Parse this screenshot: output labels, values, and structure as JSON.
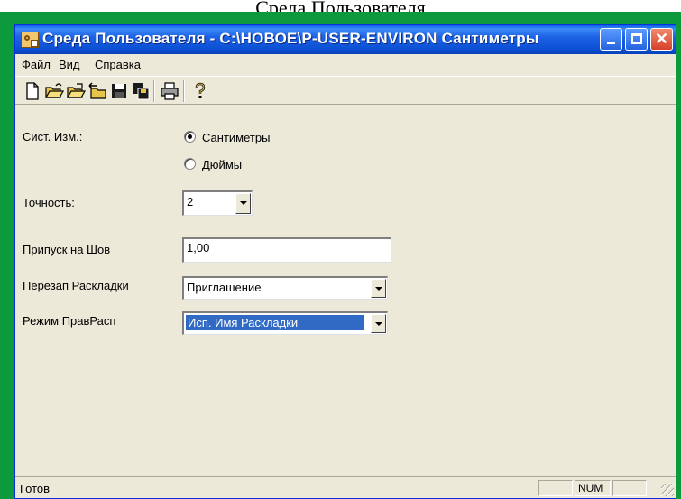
{
  "caption": "Среда Пользователя",
  "window": {
    "title": "Среда Пользователя - C:\\НОВОЕ\\P-USER-ENVIRON Сантиметры",
    "colors": {
      "titlebar": "#0a4fd3",
      "frame": "#0d9a3d",
      "selection": "#316ac5"
    }
  },
  "menu": [
    "Файл",
    "Вид",
    "Справка"
  ],
  "toolbar": {
    "icons": [
      "new-file-icon",
      "open-folder-icon",
      "open-folder-2-icon",
      "folder-arrow-icon",
      "save-icon",
      "save-all-icon",
      "print-icon",
      "help-icon"
    ]
  },
  "form": {
    "units_label": "Сист. Изм.:",
    "units_options": [
      "Сантиметры",
      "Дюймы"
    ],
    "units_selected": "Сантиметры",
    "precision_label": "Точность:",
    "precision_value": "2",
    "seam_label": "Припуск на Шов",
    "seam_value": "1,00",
    "overwrite_label": "Перезап Раскладки",
    "overwrite_value": "Приглашение",
    "mode_label": "Режим ПравРасп",
    "mode_value": "Исп. Имя Раскладки"
  },
  "status": {
    "text": "Готов",
    "num": "NUM"
  }
}
